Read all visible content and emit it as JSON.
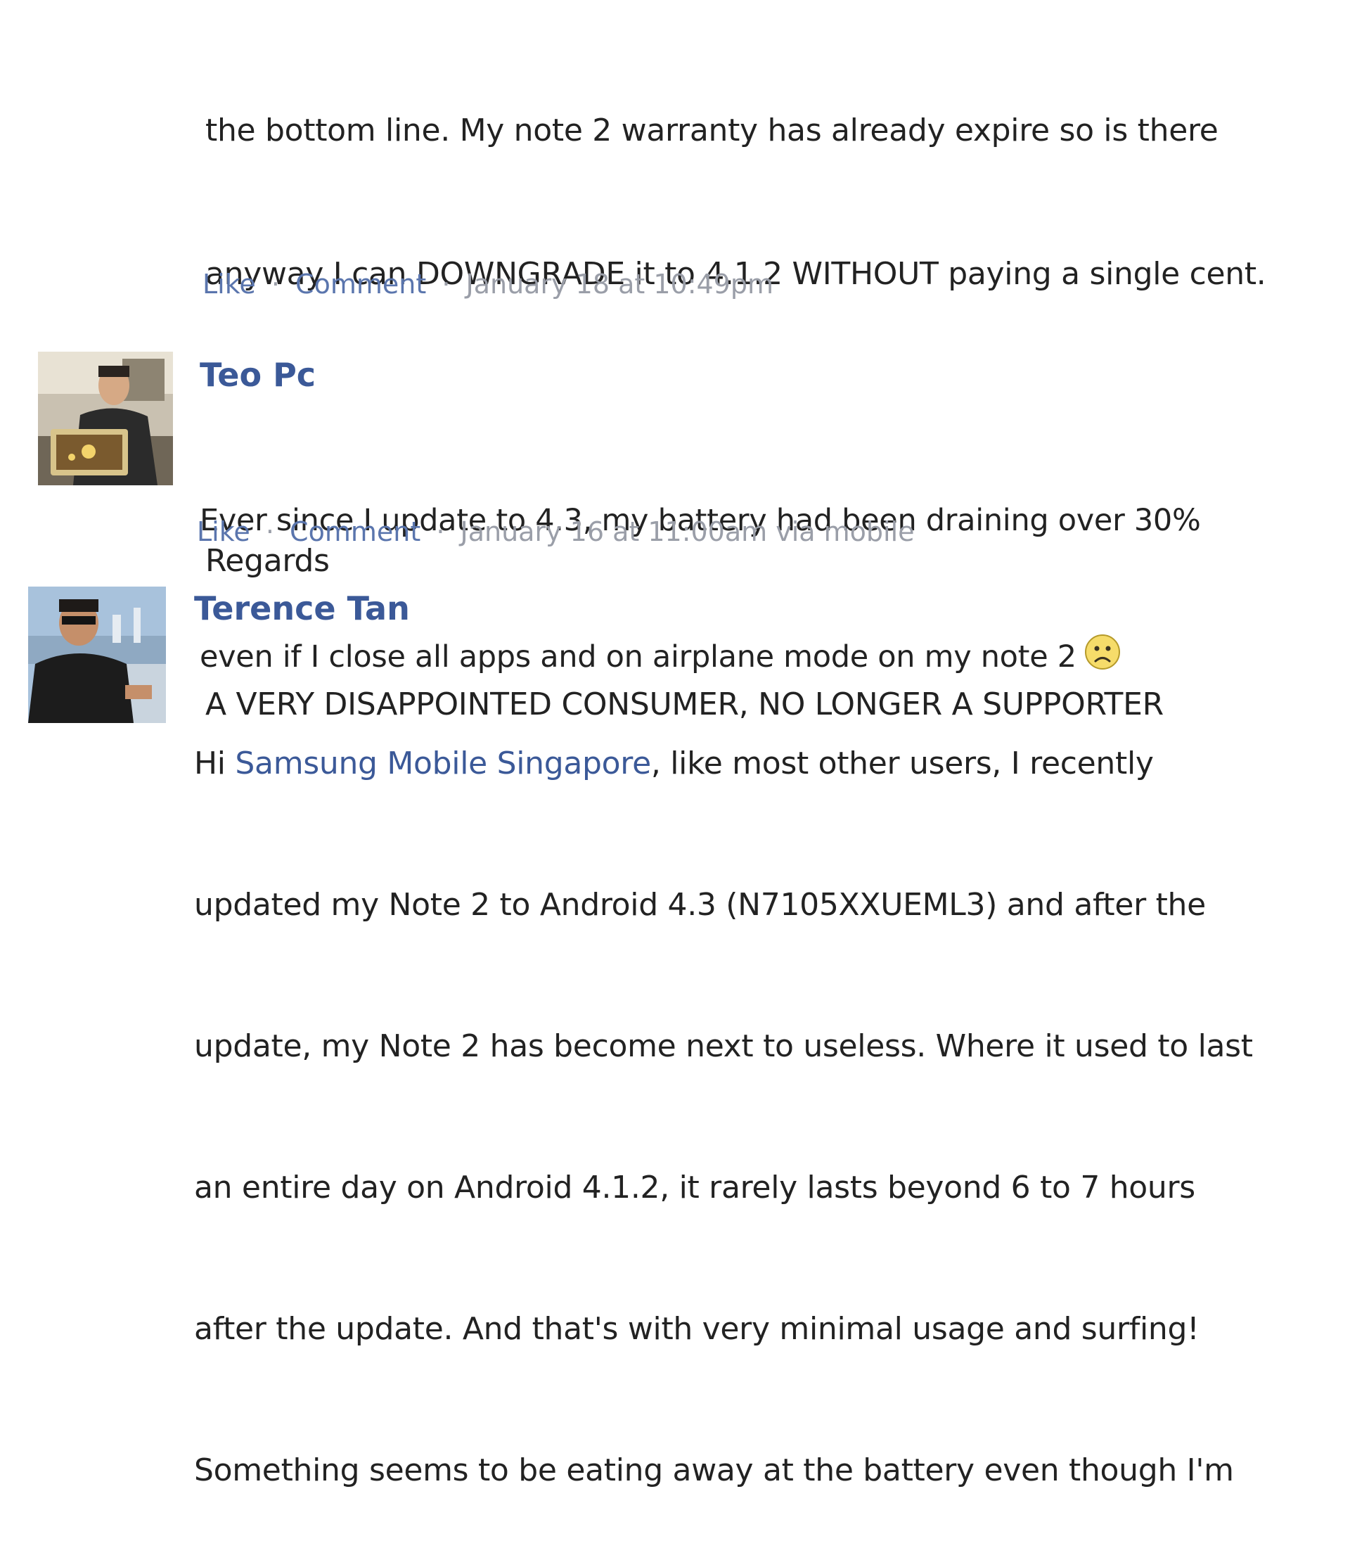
{
  "comment1": {
    "lines": [
      "the bottom line. My note 2 warranty has already expire so is there",
      "anyway I can DOWNGRADE it to 4.1.2 WITHOUT paying a single cent.",
      "",
      "Regards",
      "A VERY DISAPPOINTED CONSUMER, NO LONGER A SUPPORTER"
    ],
    "like_label": "Like",
    "comment_label": "Comment",
    "separator": "·",
    "timestamp": "January 18 at 10:49pm"
  },
  "comment2": {
    "author": "Teo Pc",
    "lines": [
      "Ever since I update to 4.3, my battery had been draining over 30%",
      "even if I close all apps and on airplane mode on my note 2"
    ],
    "emoji": "sad-face-emoji",
    "like_label": "Like",
    "comment_label": "Comment",
    "separator": "·",
    "timestamp": "January 16 at 11:00am via mobile"
  },
  "comment3": {
    "author": "Terence Tan",
    "greeting": "Hi ",
    "mention": "Samsung Mobile Singapore",
    "first_line_rest": ", like most other users, I recently",
    "lines": [
      "updated my Note 2 to Android 4.3 (N7105XXUEML3) and after the",
      "update, my Note 2 has become next to useless. Where it used to last",
      "an entire day on Android 4.1.2, it rarely lasts beyond 6 to 7 hours",
      "after the update. And that's with very minimal usage and surfing!",
      "Something seems to be eating away at the battery even though I'm"
    ]
  },
  "colors": {
    "link": "#3b5998",
    "meta": "#9a9ea8",
    "text": "#222222"
  }
}
